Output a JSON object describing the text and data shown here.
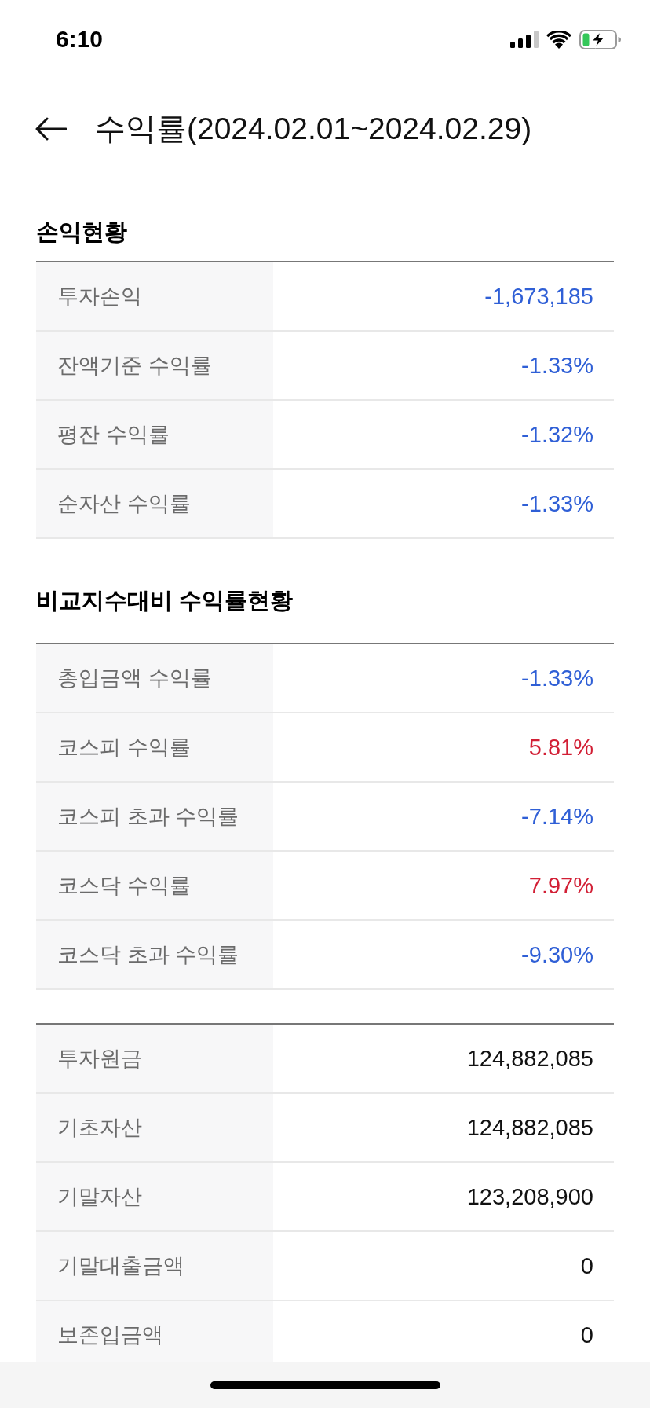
{
  "status_bar": {
    "time": "6:10"
  },
  "header": {
    "title": "수익률(2024.02.01~2024.02.29)"
  },
  "sections": [
    {
      "title": "손익현황",
      "rows": [
        {
          "label": "투자손익",
          "value": "-1,673,185",
          "color": "#2f5fd6"
        },
        {
          "label": "잔액기준 수익률",
          "value": "-1.33%",
          "color": "#2f5fd6"
        },
        {
          "label": "평잔 수익률",
          "value": "-1.32%",
          "color": "#2f5fd6"
        },
        {
          "label": "순자산 수익률",
          "value": "-1.33%",
          "color": "#2f5fd6"
        }
      ]
    },
    {
      "title": "비교지수대비 수익률현황",
      "rows": [
        {
          "label": "총입금액 수익률",
          "value": "-1.33%",
          "color": "#2f5fd6"
        },
        {
          "label": "코스피 수익률",
          "value": "5.81%",
          "color": "#d21f35"
        },
        {
          "label": "코스피 초과 수익률",
          "value": "-7.14%",
          "color": "#2f5fd6"
        },
        {
          "label": "코스닥 수익률",
          "value": "7.97%",
          "color": "#d21f35"
        },
        {
          "label": "코스닥 초과 수익률",
          "value": "-9.30%",
          "color": "#2f5fd6"
        }
      ]
    },
    {
      "rows": [
        {
          "label": "투자원금",
          "value": "124,882,085",
          "color": "#111111"
        },
        {
          "label": "기초자산",
          "value": "124,882,085",
          "color": "#111111"
        },
        {
          "label": "기말자산",
          "value": "123,208,900",
          "color": "#111111"
        },
        {
          "label": "기말대출금액",
          "value": "0",
          "color": "#111111"
        },
        {
          "label": "보존입금액",
          "value": "0",
          "color": "#111111"
        }
      ]
    }
  ]
}
